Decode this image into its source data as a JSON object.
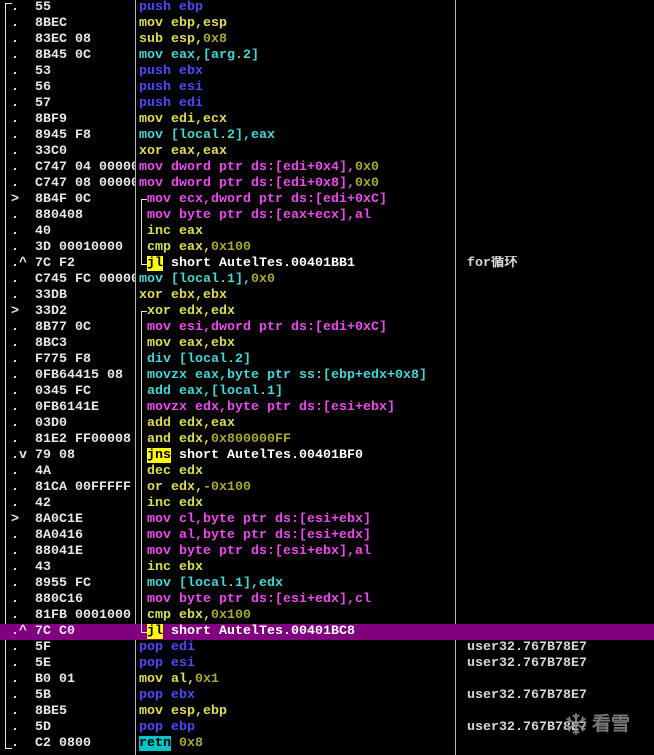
{
  "colors": {
    "background": "#000000",
    "hex": "#e8e8e8",
    "comment": "#d8d8d8",
    "selection": "#800080",
    "divider": "#b8b8b8",
    "bracket": "#e4e4e4",
    "watermark": "#8c8c8c"
  },
  "selected_row": 39,
  "loop_brackets": [
    {
      "first_row": 12,
      "last_row": 16
    },
    {
      "first_row": 19,
      "last_row": 39
    }
  ],
  "rows": [
    {
      "mark": ".",
      "hex": "55",
      "asm": [
        {
          "text": "push ebp",
          "fg": "#4a4aff"
        }
      ]
    },
    {
      "mark": ".",
      "hex": "8BEC",
      "asm": [
        {
          "text": "mov ebp,esp",
          "fg": "#dede50"
        }
      ]
    },
    {
      "mark": ".",
      "hex": "83EC 08",
      "asm": [
        {
          "text": "sub esp,",
          "fg": "#dede50"
        },
        {
          "text": "0x8",
          "fg": "#a8a830"
        }
      ]
    },
    {
      "mark": ".",
      "hex": "8B45 0C",
      "asm": [
        {
          "text": "mov eax,[arg.2]",
          "fg": "#40d8d8"
        }
      ]
    },
    {
      "mark": ".",
      "hex": "53",
      "asm": [
        {
          "text": "push ebx",
          "fg": "#4a4aff"
        }
      ]
    },
    {
      "mark": ".",
      "hex": "56",
      "asm": [
        {
          "text": "push esi",
          "fg": "#4a4aff"
        }
      ]
    },
    {
      "mark": ".",
      "hex": "57",
      "asm": [
        {
          "text": "push edi",
          "fg": "#4a4aff"
        }
      ]
    },
    {
      "mark": ".",
      "hex": "8BF9",
      "asm": [
        {
          "text": "mov edi,ecx",
          "fg": "#dede50"
        }
      ]
    },
    {
      "mark": ".",
      "hex": "8945 F8",
      "asm": [
        {
          "text": "mov [local.2],eax",
          "fg": "#40d8d8"
        }
      ]
    },
    {
      "mark": ".",
      "hex": "33C0",
      "asm": [
        {
          "text": "xor eax,eax",
          "fg": "#dede50"
        }
      ]
    },
    {
      "mark": ".",
      "hex": "C747 04 00000",
      "asm": [
        {
          "text": "mov dword ptr ds:[edi+0x4],",
          "fg": "#f048f0"
        },
        {
          "text": "0x0",
          "fg": "#a8a830"
        }
      ]
    },
    {
      "mark": ".",
      "hex": "C747 08 00000",
      "asm": [
        {
          "text": "mov dword ptr ds:[edi+0x8],",
          "fg": "#f048f0"
        },
        {
          "text": "0x0",
          "fg": "#a8a830"
        }
      ]
    },
    {
      "mark": ">",
      "hex": "8B4F 0C",
      "asm": [
        {
          "text": "mov ecx,dword ptr ds:[edi+0xC]",
          "fg": "#f048f0"
        }
      ]
    },
    {
      "mark": ".",
      "hex": "880408",
      "asm": [
        {
          "text": "mov byte ptr ds:[eax+ecx],al",
          "fg": "#f048f0"
        }
      ]
    },
    {
      "mark": ".",
      "hex": "40",
      "asm": [
        {
          "text": "inc eax",
          "fg": "#dede50"
        }
      ]
    },
    {
      "mark": ".",
      "hex": "3D 00010000",
      "asm": [
        {
          "text": "cmp eax,",
          "fg": "#dede50"
        },
        {
          "text": "0x100",
          "fg": "#a8a830"
        }
      ]
    },
    {
      "mark": ".^",
      "hex": "7C F2",
      "asm": [
        {
          "text": "jl",
          "fg": "#000000",
          "bg": "#ffff00"
        },
        {
          "text": " short AutelTes.00401BB1",
          "fg": "#ffffff"
        }
      ],
      "comment": "for循环"
    },
    {
      "mark": ".",
      "hex": "C745 FC 00000",
      "asm": [
        {
          "text": "mov [local.1],",
          "fg": "#40d8d8"
        },
        {
          "text": "0x0",
          "fg": "#a8a830"
        }
      ]
    },
    {
      "mark": ".",
      "hex": "33DB",
      "asm": [
        {
          "text": "xor ebx,ebx",
          "fg": "#dede50"
        }
      ]
    },
    {
      "mark": ">",
      "hex": "33D2",
      "asm": [
        {
          "text": "xor edx,edx",
          "fg": "#dede50"
        }
      ]
    },
    {
      "mark": ".",
      "hex": "8B77 0C",
      "asm": [
        {
          "text": "mov esi,dword ptr ds:[edi+0xC]",
          "fg": "#f048f0"
        }
      ]
    },
    {
      "mark": ".",
      "hex": "8BC3",
      "asm": [
        {
          "text": "mov eax,ebx",
          "fg": "#dede50"
        }
      ]
    },
    {
      "mark": ".",
      "hex": "F775 F8",
      "asm": [
        {
          "text": "div [local.2]",
          "fg": "#40d8d8"
        }
      ]
    },
    {
      "mark": ".",
      "hex": "0FB64415 08",
      "asm": [
        {
          "text": "movzx eax,byte ptr ss:[ebp+edx+0x8]",
          "fg": "#40d8d8"
        }
      ]
    },
    {
      "mark": ".",
      "hex": "0345 FC",
      "asm": [
        {
          "text": "add eax,[local.1]",
          "fg": "#40d8d8"
        }
      ]
    },
    {
      "mark": ".",
      "hex": "0FB6141E",
      "asm": [
        {
          "text": "movzx edx,byte ptr ds:[esi+ebx]",
          "fg": "#f048f0"
        }
      ]
    },
    {
      "mark": ".",
      "hex": "03D0",
      "asm": [
        {
          "text": "add edx,eax",
          "fg": "#dede50"
        }
      ]
    },
    {
      "mark": ".",
      "hex": "81E2 FF00008",
      "asm": [
        {
          "text": "and edx,",
          "fg": "#dede50"
        },
        {
          "text": "0x800000FF",
          "fg": "#a8a830"
        }
      ]
    },
    {
      "mark": ".v",
      "hex": "79 08",
      "asm": [
        {
          "text": "jns",
          "fg": "#000000",
          "bg": "#ffff00"
        },
        {
          "text": " short AutelTes.00401BF0",
          "fg": "#ffffff"
        }
      ]
    },
    {
      "mark": ".",
      "hex": "4A",
      "asm": [
        {
          "text": "dec edx",
          "fg": "#dede50"
        }
      ]
    },
    {
      "mark": ".",
      "hex": "81CA 00FFFFF",
      "asm": [
        {
          "text": "or edx,",
          "fg": "#dede50"
        },
        {
          "text": "-0x100",
          "fg": "#a8a830"
        }
      ]
    },
    {
      "mark": ".",
      "hex": "42",
      "asm": [
        {
          "text": "inc edx",
          "fg": "#dede50"
        }
      ]
    },
    {
      "mark": ">",
      "hex": "8A0C1E",
      "asm": [
        {
          "text": "mov cl,byte ptr ds:[esi+ebx]",
          "fg": "#f048f0"
        }
      ]
    },
    {
      "mark": ".",
      "hex": "8A0416",
      "asm": [
        {
          "text": "mov al,byte ptr ds:[esi+edx]",
          "fg": "#f048f0"
        }
      ]
    },
    {
      "mark": ".",
      "hex": "88041E",
      "asm": [
        {
          "text": "mov byte ptr ds:[esi+ebx],al",
          "fg": "#f048f0"
        }
      ]
    },
    {
      "mark": ".",
      "hex": "43",
      "asm": [
        {
          "text": "inc ebx",
          "fg": "#dede50"
        }
      ]
    },
    {
      "mark": ".",
      "hex": "8955 FC",
      "asm": [
        {
          "text": "mov [local.1],edx",
          "fg": "#40d8d8"
        }
      ]
    },
    {
      "mark": ".",
      "hex": "880C16",
      "asm": [
        {
          "text": "mov byte ptr ds:[esi+edx],cl",
          "fg": "#f048f0"
        }
      ]
    },
    {
      "mark": ".",
      "hex": "81FB 0001000",
      "asm": [
        {
          "text": "cmp ebx,",
          "fg": "#dede50"
        },
        {
          "text": "0x100",
          "fg": "#a8a830"
        }
      ]
    },
    {
      "mark": ".^",
      "hex": "7C C0",
      "asm": [
        {
          "text": "jl",
          "fg": "#000000",
          "bg": "#ffff00"
        },
        {
          "text": " short AutelTes.00401BC8",
          "fg": "#ffffff"
        }
      ]
    },
    {
      "mark": ".",
      "hex": "5F",
      "asm": [
        {
          "text": "pop edi",
          "fg": "#4a4aff"
        }
      ],
      "comment": "user32.767B78E7"
    },
    {
      "mark": ".",
      "hex": "5E",
      "asm": [
        {
          "text": "pop esi",
          "fg": "#4a4aff"
        }
      ],
      "comment": "user32.767B78E7"
    },
    {
      "mark": ".",
      "hex": "B0 01",
      "asm": [
        {
          "text": "mov al,",
          "fg": "#dede50"
        },
        {
          "text": "0x1",
          "fg": "#a8a830"
        }
      ]
    },
    {
      "mark": ".",
      "hex": "5B",
      "asm": [
        {
          "text": "pop ebx",
          "fg": "#4a4aff"
        }
      ],
      "comment": "user32.767B78E7"
    },
    {
      "mark": ".",
      "hex": "8BE5",
      "asm": [
        {
          "text": "mov esp,ebp",
          "fg": "#dede50"
        }
      ]
    },
    {
      "mark": ".",
      "hex": "5D",
      "asm": [
        {
          "text": "pop ebp",
          "fg": "#4a4aff"
        }
      ],
      "comment": "user32.767B78E7"
    },
    {
      "mark": ".",
      "hex": "C2 0800",
      "asm": [
        {
          "text": "retn",
          "fg": "#000000",
          "bg": "#00c4c4"
        },
        {
          "text": " 0x8",
          "fg": "#a8a830"
        }
      ]
    }
  ],
  "watermark": {
    "icon": "snowflake-icon",
    "text": "看雪"
  }
}
